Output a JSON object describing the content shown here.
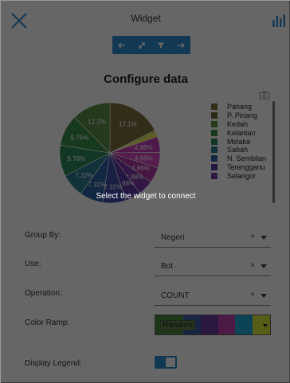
{
  "header": {
    "title": "Widget"
  },
  "toolbar": {
    "icons": [
      "arrow-left-icon",
      "expand-icon",
      "filter-icon",
      "arrow-right-icon"
    ]
  },
  "config": {
    "title": "Configure data"
  },
  "overlay": {
    "message": "Select the widget to connect"
  },
  "chart_data": {
    "type": "pie",
    "labels": [
      "Pahang",
      "P. Pinang",
      "Kedah",
      "Kelantan",
      "Melaka",
      "Sabah",
      "N. Sembilan",
      "Terengganu",
      "Selangor"
    ],
    "legend_labels_shown": [
      "Pahang",
      "P. Pinang",
      "Kedah",
      "Kelantan",
      "Melaka",
      "Sabah",
      "N. Sembilan",
      "Terengganu",
      "Selangor"
    ],
    "slices": [
      {
        "value": 17.1,
        "label": "17.1%",
        "color": "#7e7040"
      },
      {
        "value": 1.0,
        "label": "",
        "color": "#cfe04a"
      },
      {
        "value": 1.2,
        "label": "",
        "color": "#f0e050"
      },
      {
        "value": 4.88,
        "label": "4.88%",
        "color": "#c43fb6"
      },
      {
        "value": 4.88,
        "label": "4.88%",
        "color": "#d446bf"
      },
      {
        "value": 4.88,
        "label": "4.88%",
        "color": "#b03aa6"
      },
      {
        "value": 4.88,
        "label": "4.88%",
        "color": "#7a3aa8"
      },
      {
        "value": 4.88,
        "label": "4.88%",
        "color": "#5a3aa4"
      },
      {
        "value": 7.32,
        "label": "7.32%",
        "color": "#3d4ea8"
      },
      {
        "value": 7.32,
        "label": "7.32%",
        "color": "#2f62a6"
      },
      {
        "value": 7.32,
        "label": "7.32%",
        "color": "#2c7d8e"
      },
      {
        "value": 9.76,
        "label": "9.76%",
        "color": "#2f8c5c"
      },
      {
        "value": 9.76,
        "label": "9.76%",
        "color": "#3a8f4a"
      },
      {
        "value": 12.2,
        "label": "12.2%",
        "color": "#5d8f4a"
      }
    ]
  },
  "form": {
    "group_by": {
      "label": "Group By:",
      "value": "Negeri",
      "clear": "×"
    },
    "use": {
      "label": "Use:",
      "value": "Bot",
      "clear": "×"
    },
    "operation": {
      "label": "Operation:",
      "value": "COUNT",
      "clear": "×"
    },
    "color_ramp": {
      "label": "Color Ramp:",
      "value": "Random",
      "colors": [
        "#4e8a3f",
        "#3c5da8",
        "#6b3da2",
        "#c042b0",
        "#1fa8d8",
        "#d8e83a"
      ]
    },
    "display_legend": {
      "label": "Display Legend:",
      "on": true
    }
  }
}
